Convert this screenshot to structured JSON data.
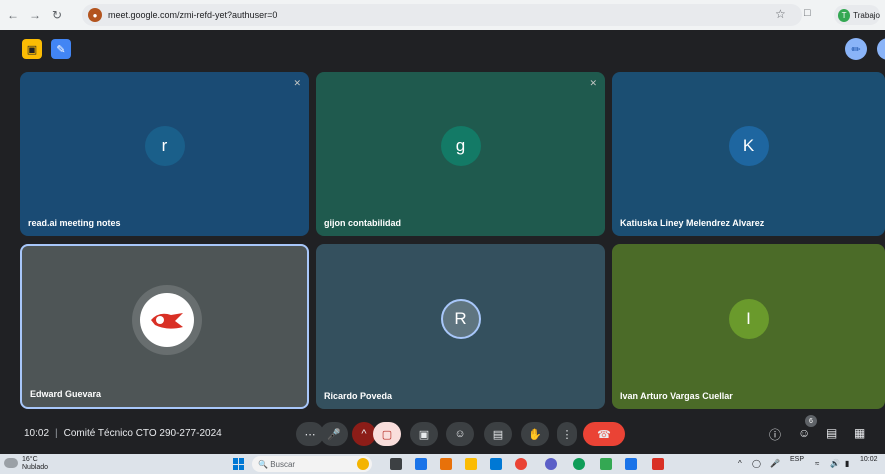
{
  "browser": {
    "url": "meet.google.com/zmi-refd-yet?authuser=0",
    "profile_label": "Trabajo",
    "profile_initial": "T"
  },
  "tiles": [
    {
      "name": "read.ai meeting notes",
      "initial": "r",
      "bg": "#1a4b74",
      "avatar": "#1a5f8a",
      "muted": true
    },
    {
      "name": "gijon contabilidad",
      "initial": "g",
      "bg": "#1f5a4e",
      "avatar": "#137a66",
      "muted": true
    },
    {
      "name": "Katiuska Liney Melendrez Alvarez",
      "initial": "K",
      "bg": "#1b4e72",
      "avatar": "#1e66a0",
      "muted": false
    },
    {
      "name": "Edward Guevara",
      "initial": "",
      "bg": "#4e5556",
      "avatar": "#ffffff",
      "muted": false
    },
    {
      "name": "Ricardo Poveda",
      "initial": "R",
      "bg": "#34505e",
      "avatar": "#5f7580",
      "muted": false
    },
    {
      "name": "Ivan Arturo Vargas Cuellar",
      "initial": "I",
      "bg": "#4b6b28",
      "avatar": "#6a9a2c",
      "muted": false
    }
  ],
  "meeting": {
    "time": "10:02",
    "title": "Comité Técnico CTO 290-277-2024",
    "participant_count": "6"
  },
  "taskbar": {
    "temp": "16°C",
    "weather_desc": "Nublado",
    "search_placeholder": "Buscar",
    "lang": "ESP",
    "clock": "10:02"
  },
  "colors": {
    "meet_bg": "#202124",
    "end_call": "#ea4335",
    "accent_blue": "#8ab4f8"
  }
}
